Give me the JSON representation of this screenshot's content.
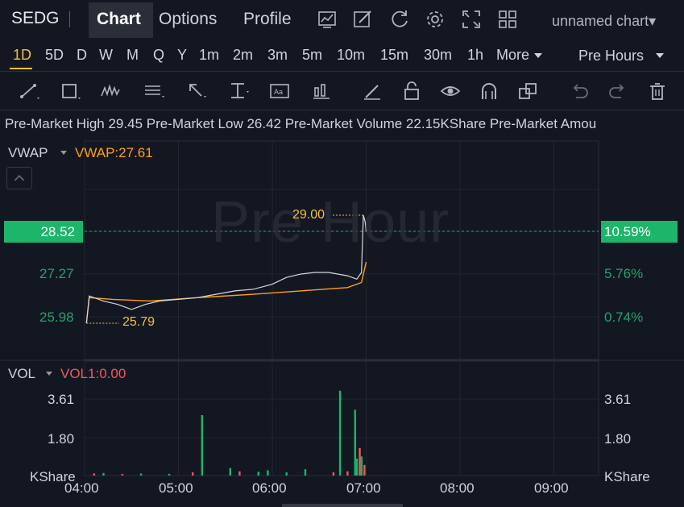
{
  "header": {
    "ticker": "SEDG",
    "tabs": [
      {
        "label": "Chart",
        "active": true
      },
      {
        "label": "Options",
        "active": false
      },
      {
        "label": "Profile",
        "active": false
      }
    ],
    "toolbar_icons": [
      "chart-type-icon",
      "draw-pen-icon",
      "refresh-icon",
      "settings-icon",
      "fullscreen-icon",
      "layout-grid-icon"
    ],
    "chart_name": "unnamed chart▾"
  },
  "intervals": {
    "items": [
      "1D",
      "5D",
      "D",
      "W",
      "M",
      "Q",
      "Y",
      "1m",
      "2m",
      "3m",
      "5m",
      "10m",
      "15m",
      "30m",
      "1h",
      "More"
    ],
    "selected": "1D",
    "session": "Pre Hours"
  },
  "drawing_tools": [
    "trend-line-icon",
    "rectangle-icon",
    "pattern-icon",
    "fib-icon",
    "arrow-icon",
    "measure-icon",
    "text-icon",
    "indicator-icon",
    "brush-icon",
    "lock-icon",
    "eye-icon",
    "magnet-icon",
    "clone-icon",
    "undo-icon",
    "redo-icon",
    "trash-icon"
  ],
  "info": {
    "text": "Pre-Market High 29.45 Pre-Market Low 26.42 Pre-Market Volume 22.15KShare Pre-Market Amou"
  },
  "price_panel": {
    "indicator": "VWAP",
    "indicator_value": "VWAP:27.61",
    "watermark": "Pre Hour",
    "left_axis": [
      "27.27",
      "25.98"
    ],
    "right_axis": [
      "5.76%",
      "0.74%"
    ],
    "last_price": "28.52",
    "last_pct": "10.59%",
    "high_marker": "29.00",
    "low_marker": "25.79"
  },
  "volume_panel": {
    "indicator": "VOL",
    "indicator_value": "VOL1:0.00",
    "left_axis": [
      "3.61",
      "1.80",
      "KShare"
    ],
    "right_axis": [
      "3.61",
      "1.80",
      "KShare"
    ]
  },
  "time_axis": [
    "04:00",
    "05:00",
    "06:00",
    "07:00",
    "08:00",
    "09:00"
  ],
  "colors": {
    "background": "#131722",
    "up": "#1cb56a",
    "down": "#f05a5a",
    "vwap": "#ff9f1a",
    "accent": "#f0c23b",
    "price_line": "#d8d8d8"
  },
  "chart_data": {
    "type": "line",
    "price_series": [
      [
        4.02,
        25.79
      ],
      [
        4.05,
        26.6
      ],
      [
        4.1,
        26.55
      ],
      [
        4.2,
        26.45
      ],
      [
        4.35,
        26.35
      ],
      [
        4.5,
        26.2
      ],
      [
        4.65,
        26.35
      ],
      [
        4.8,
        26.45
      ],
      [
        5.0,
        26.5
      ],
      [
        5.2,
        26.55
      ],
      [
        5.4,
        26.65
      ],
      [
        5.6,
        26.75
      ],
      [
        5.8,
        26.8
      ],
      [
        6.0,
        26.95
      ],
      [
        6.15,
        27.15
      ],
      [
        6.3,
        27.25
      ],
      [
        6.45,
        27.3
      ],
      [
        6.6,
        27.3
      ],
      [
        6.8,
        27.2
      ],
      [
        6.9,
        27.1
      ],
      [
        6.95,
        27.3
      ],
      [
        6.97,
        29.0
      ],
      [
        6.99,
        28.8
      ],
      [
        7.0,
        28.52
      ]
    ],
    "vwap_series": [
      [
        4.02,
        25.79
      ],
      [
        4.05,
        26.55
      ],
      [
        4.3,
        26.5
      ],
      [
        4.7,
        26.45
      ],
      [
        5.2,
        26.55
      ],
      [
        5.8,
        26.65
      ],
      [
        6.3,
        26.75
      ],
      [
        6.8,
        26.85
      ],
      [
        6.95,
        27.0
      ],
      [
        7.0,
        27.61
      ]
    ],
    "volume_bars": [
      [
        4.1,
        0.1,
        "down"
      ],
      [
        4.2,
        0.12,
        "up"
      ],
      [
        4.4,
        0.08,
        "down"
      ],
      [
        4.6,
        0.1,
        "up"
      ],
      [
        4.9,
        0.08,
        "up"
      ],
      [
        5.15,
        0.15,
        "down"
      ],
      [
        5.25,
        2.85,
        "up"
      ],
      [
        5.55,
        0.35,
        "up"
      ],
      [
        5.65,
        0.2,
        "down"
      ],
      [
        5.85,
        0.18,
        "up"
      ],
      [
        5.95,
        0.25,
        "up"
      ],
      [
        6.15,
        0.15,
        "up"
      ],
      [
        6.35,
        0.3,
        "up"
      ],
      [
        6.65,
        0.15,
        "down"
      ],
      [
        6.72,
        4.0,
        "up"
      ],
      [
        6.8,
        0.2,
        "down"
      ],
      [
        6.88,
        3.1,
        "up"
      ],
      [
        6.9,
        0.8,
        "up"
      ],
      [
        6.93,
        1.3,
        "down"
      ],
      [
        6.95,
        0.9,
        "up"
      ],
      [
        6.98,
        0.5,
        "down"
      ]
    ],
    "xlim": [
      4.0,
      9.5
    ],
    "ylim_price": [
      25.2,
      29.6
    ],
    "ylim_volume": [
      0,
      4.2
    ]
  }
}
